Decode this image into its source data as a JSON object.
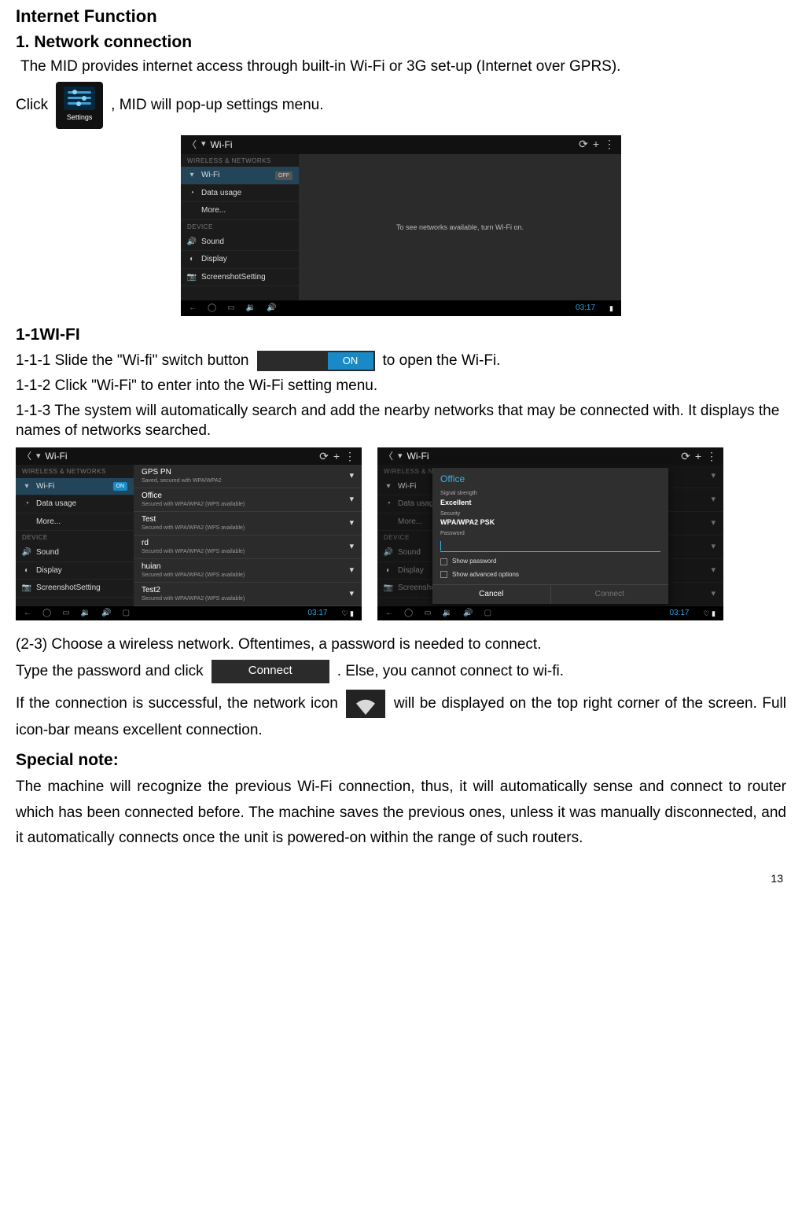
{
  "page_number": "13",
  "headings": {
    "internet_function": "Internet Function",
    "network_connection": "1. Network connection",
    "wifi": "1-1WI-FI",
    "special_note": "Special note:"
  },
  "body": {
    "p1": "The MID provides internet access through built-in Wi-Fi or 3G set-up (Internet over GPRS).",
    "click_pre": "Click",
    "click_post": ", MID will pop-up settings menu.",
    "steps": {
      "s1_pre": "1-1-1 Slide the \"Wi-fi\" switch button",
      "s1_post": "to open the Wi-Fi.",
      "s2": "1-1-2 Click \"Wi-Fi\" to enter into the Wi-Fi setting menu.",
      "s3": "1-1-3 The system will automatically search and add the nearby networks that may be connected with. It displays the names of networks searched."
    },
    "p2": "(2-3) Choose a wireless network. Oftentimes, a password is needed to connect.",
    "type_pre": "Type the password and click",
    "type_post": ". Else, you cannot connect to wi-fi.",
    "p3_pre": "If the connection is successful, the network icon",
    "p3_post": "will be displayed on the top right corner of the screen. Full icon-bar means excellent connection.",
    "special_note_text": "The machine will recognize the previous Wi-Fi connection, thus, it will automatically sense and connect to router which has been connected before. The machine saves the previous ones, unless it was manually disconnected, and it automatically connects once the unit is powered-on within the range of such routers."
  },
  "inline": {
    "settings_label": "Settings",
    "on_label": "ON",
    "connect_label": "Connect"
  },
  "android": {
    "topbar": {
      "title": "Wi-Fi",
      "refresh": "⟳",
      "add": "+",
      "menu": "⋮"
    },
    "section_wireless": "WIRELESS & NETWORKS",
    "section_device": "DEVICE",
    "sidebar": {
      "wifi": "Wi-Fi",
      "data": "Data usage",
      "more": "More...",
      "sound": "Sound",
      "display": "Display",
      "screenshot": "ScreenshotSetting"
    },
    "switch_off": "OFF",
    "switch_on": "ON",
    "off_message": "To see networks available, turn Wi-Fi on.",
    "clock": "03:17",
    "networks": [
      {
        "name": "GPS PN",
        "sub": "Saved, secured with WPA/WPA2"
      },
      {
        "name": "Office",
        "sub": "Secured with WPA/WPA2 (WPS available)"
      },
      {
        "name": "Test",
        "sub": "Secured with WPA/WPA2 (WPS available)"
      },
      {
        "name": "rd",
        "sub": "Secured with WPA/WPA2 (WPS available)"
      },
      {
        "name": "huian",
        "sub": "Secured with WPA/WPA2 (WPS available)"
      },
      {
        "name": "Test2",
        "sub": "Secured with WPA/WPA2 (WPS available)"
      }
    ],
    "dialog": {
      "title": "Office",
      "signal_lbl": "Signal strength",
      "signal_val": "Excellent",
      "security_lbl": "Security",
      "security_val": "WPA/WPA2 PSK",
      "password_lbl": "Password",
      "show_pw": "Show password",
      "show_adv": "Show advanced options",
      "cancel": "Cancel",
      "connect": "Connect"
    },
    "nav": {
      "back": "←",
      "home": "◯",
      "recent": "▭",
      "voldown": "🔉",
      "volup": "🔊",
      "screenshot": "▢"
    }
  }
}
